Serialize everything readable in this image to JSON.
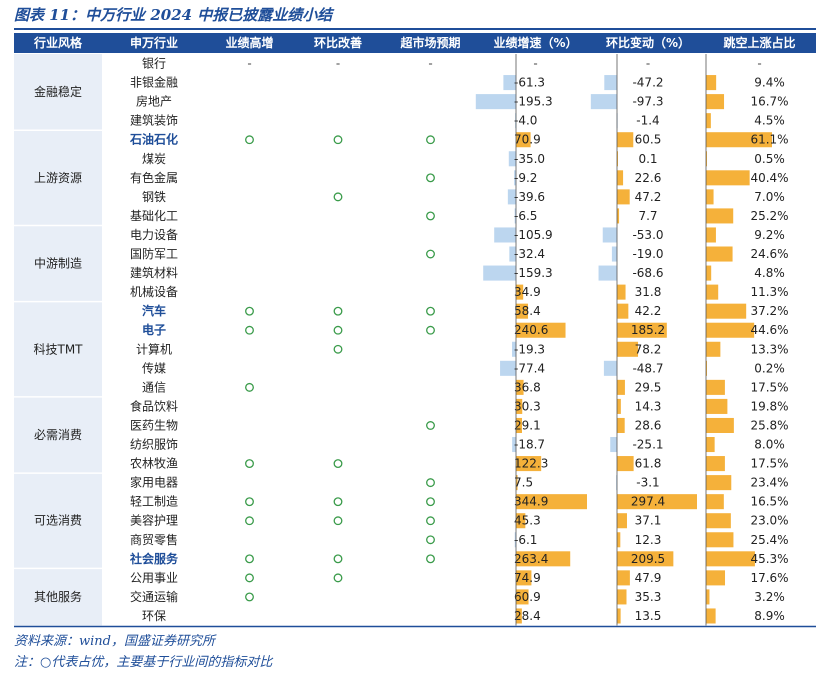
{
  "title": "图表 11：中万行业 2024 中报已披露业绩小结",
  "footer": {
    "source": "资料来源：wind，国盛证券研究所",
    "note": "注：○代表占优，主要基于行业间的指标对比"
  },
  "colors": {
    "header_bg": "#1f4e99",
    "positive_bar": "#f5b13a",
    "negative_bar": "#bcd6ef",
    "mark": "#3a9b4a",
    "group_band": "#e8eef7",
    "highlight_text": "#1f4e99"
  },
  "mark_symbol": "○",
  "dash_symbol": "-",
  "chart_data": {
    "type": "table",
    "columns": [
      "行业风格",
      "申万行业",
      "业绩高增",
      "环比改善",
      "超市场预期",
      "业绩增速（%）",
      "环比变动（%）",
      "跳空上涨占比"
    ],
    "groups": [
      {
        "name": "金融稳定",
        "start": 0,
        "count": 4
      },
      {
        "name": "上游资源",
        "start": 4,
        "count": 5
      },
      {
        "name": "中游制造",
        "start": 9,
        "count": 4
      },
      {
        "name": "科技TMT",
        "start": 13,
        "count": 5
      },
      {
        "name": "必需消费",
        "start": 18,
        "count": 4
      },
      {
        "name": "可选消费",
        "start": 22,
        "count": 5
      },
      {
        "name": "其他服务",
        "start": 27,
        "count": 3
      }
    ],
    "rows": [
      {
        "industry": "银行",
        "highlight": false,
        "high_growth": "-",
        "qoq_improve": "-",
        "beat": "-",
        "growth": "-",
        "qoq": "-",
        "gap_up": "-"
      },
      {
        "industry": "非银金融",
        "highlight": false,
        "high_growth": "",
        "qoq_improve": "",
        "beat": "",
        "growth": -61.3,
        "qoq": -47.2,
        "gap_up": 9.4
      },
      {
        "industry": "房地产",
        "highlight": false,
        "high_growth": "",
        "qoq_improve": "",
        "beat": "",
        "growth": -195.3,
        "qoq": -97.3,
        "gap_up": 16.7
      },
      {
        "industry": "建筑装饰",
        "highlight": false,
        "high_growth": "",
        "qoq_improve": "",
        "beat": "",
        "growth": -4.0,
        "qoq": -1.4,
        "gap_up": 4.5
      },
      {
        "industry": "石油石化",
        "highlight": true,
        "high_growth": "○",
        "qoq_improve": "○",
        "beat": "○",
        "growth": 70.9,
        "qoq": 60.5,
        "gap_up": 61.1
      },
      {
        "industry": "煤炭",
        "highlight": false,
        "high_growth": "",
        "qoq_improve": "",
        "beat": "",
        "growth": -35.0,
        "qoq": 0.1,
        "gap_up": 0.5
      },
      {
        "industry": "有色金属",
        "highlight": false,
        "high_growth": "",
        "qoq_improve": "",
        "beat": "○",
        "growth": -9.2,
        "qoq": 22.6,
        "gap_up": 40.4
      },
      {
        "industry": "钢铁",
        "highlight": false,
        "high_growth": "",
        "qoq_improve": "○",
        "beat": "",
        "growth": -39.6,
        "qoq": 47.2,
        "gap_up": 7.0
      },
      {
        "industry": "基础化工",
        "highlight": false,
        "high_growth": "",
        "qoq_improve": "",
        "beat": "○",
        "growth": -6.5,
        "qoq": 7.7,
        "gap_up": 25.2
      },
      {
        "industry": "电力设备",
        "highlight": false,
        "high_growth": "",
        "qoq_improve": "",
        "beat": "",
        "growth": -105.9,
        "qoq": -53.0,
        "gap_up": 9.2
      },
      {
        "industry": "国防军工",
        "highlight": false,
        "high_growth": "",
        "qoq_improve": "",
        "beat": "○",
        "growth": -32.4,
        "qoq": -19.0,
        "gap_up": 24.6
      },
      {
        "industry": "建筑材料",
        "highlight": false,
        "high_growth": "",
        "qoq_improve": "",
        "beat": "",
        "growth": -159.3,
        "qoq": -68.6,
        "gap_up": 4.8
      },
      {
        "industry": "机械设备",
        "highlight": false,
        "high_growth": "",
        "qoq_improve": "",
        "beat": "",
        "growth": 34.9,
        "qoq": 31.8,
        "gap_up": 11.3
      },
      {
        "industry": "汽车",
        "highlight": true,
        "high_growth": "○",
        "qoq_improve": "○",
        "beat": "○",
        "growth": 58.4,
        "qoq": 42.2,
        "gap_up": 37.2
      },
      {
        "industry": "电子",
        "highlight": true,
        "high_growth": "○",
        "qoq_improve": "○",
        "beat": "○",
        "growth": 240.6,
        "qoq": 185.2,
        "gap_up": 44.6
      },
      {
        "industry": "计算机",
        "highlight": false,
        "high_growth": "",
        "qoq_improve": "○",
        "beat": "",
        "growth": -19.3,
        "qoq": 78.2,
        "gap_up": 13.3
      },
      {
        "industry": "传媒",
        "highlight": false,
        "high_growth": "",
        "qoq_improve": "",
        "beat": "",
        "growth": -77.4,
        "qoq": -48.7,
        "gap_up": 0.2
      },
      {
        "industry": "通信",
        "highlight": false,
        "high_growth": "○",
        "qoq_improve": "",
        "beat": "",
        "growth": 36.8,
        "qoq": 29.5,
        "gap_up": 17.5
      },
      {
        "industry": "食品饮料",
        "highlight": false,
        "high_growth": "",
        "qoq_improve": "",
        "beat": "",
        "growth": 30.3,
        "qoq": 14.3,
        "gap_up": 19.8
      },
      {
        "industry": "医药生物",
        "highlight": false,
        "high_growth": "",
        "qoq_improve": "",
        "beat": "○",
        "growth": 29.1,
        "qoq": 28.6,
        "gap_up": 25.8
      },
      {
        "industry": "纺织服饰",
        "highlight": false,
        "high_growth": "",
        "qoq_improve": "",
        "beat": "",
        "growth": -18.7,
        "qoq": -25.1,
        "gap_up": 8.0
      },
      {
        "industry": "农林牧渔",
        "highlight": false,
        "high_growth": "○",
        "qoq_improve": "○",
        "beat": "",
        "growth": 122.3,
        "qoq": 61.8,
        "gap_up": 17.5
      },
      {
        "industry": "家用电器",
        "highlight": false,
        "high_growth": "",
        "qoq_improve": "",
        "beat": "○",
        "growth": 7.5,
        "qoq": -3.1,
        "gap_up": 23.4
      },
      {
        "industry": "轻工制造",
        "highlight": false,
        "high_growth": "○",
        "qoq_improve": "○",
        "beat": "○",
        "growth": 344.9,
        "qoq": 297.4,
        "gap_up": 16.5
      },
      {
        "industry": "美容护理",
        "highlight": false,
        "high_growth": "○",
        "qoq_improve": "○",
        "beat": "○",
        "growth": 45.3,
        "qoq": 37.1,
        "gap_up": 23.0
      },
      {
        "industry": "商贸零售",
        "highlight": false,
        "high_growth": "",
        "qoq_improve": "",
        "beat": "○",
        "growth": -6.1,
        "qoq": 12.3,
        "gap_up": 25.4
      },
      {
        "industry": "社会服务",
        "highlight": true,
        "high_growth": "○",
        "qoq_improve": "○",
        "beat": "○",
        "growth": 263.4,
        "qoq": 209.5,
        "gap_up": 45.3
      },
      {
        "industry": "公用事业",
        "highlight": false,
        "high_growth": "○",
        "qoq_improve": "○",
        "beat": "",
        "growth": 74.9,
        "qoq": 47.9,
        "gap_up": 17.6
      },
      {
        "industry": "交通运输",
        "highlight": false,
        "high_growth": "○",
        "qoq_improve": "",
        "beat": "",
        "growth": 60.9,
        "qoq": 35.3,
        "gap_up": 3.2
      },
      {
        "industry": "环保",
        "highlight": false,
        "high_growth": "",
        "qoq_improve": "",
        "beat": "",
        "growth": 28.4,
        "qoq": 13.5,
        "gap_up": 8.9
      }
    ]
  }
}
